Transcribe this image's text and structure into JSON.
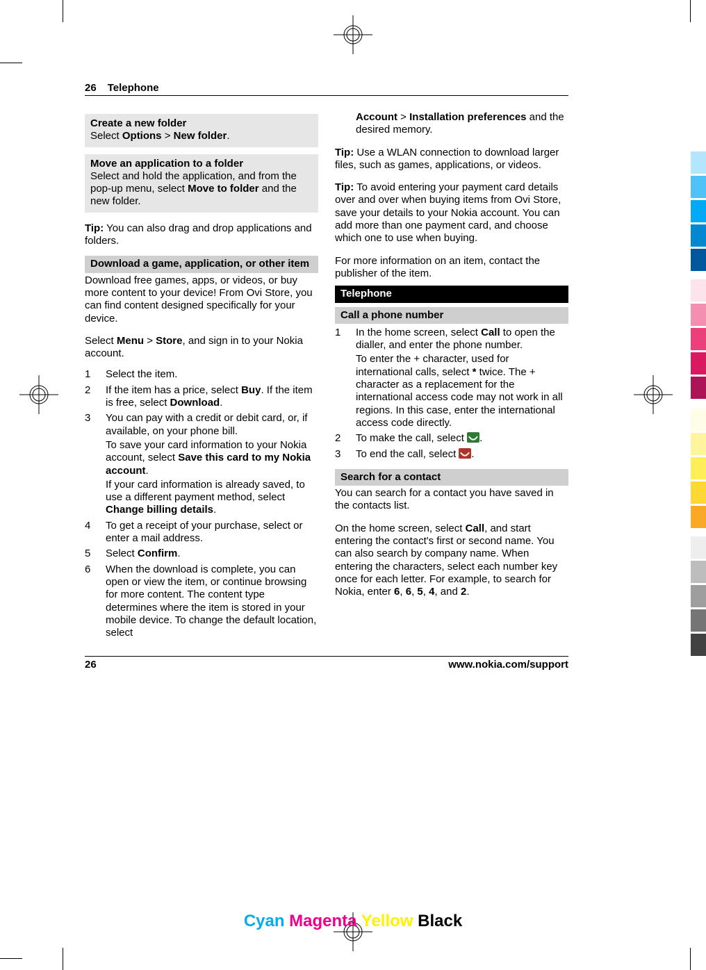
{
  "header": {
    "pageNum": "26",
    "section": "Telephone"
  },
  "left": {
    "createHeader": "Create a new folder",
    "createBody": "Select <b>Options</b>  > <b>New folder</b>.",
    "moveHeader": "Move an application to a folder",
    "moveBody": "Select and hold the application, and from the pop-up menu, select <b>Move to folder</b> and the new folder.",
    "tip1": "<b>Tip:</b> You can also drag and drop applications and folders.",
    "dlHeader": "Download a game, application, or other item",
    "dlBody": "Download free games, apps, or videos, or buy more content to your device! From Ovi Store, you can find content designed specifically for your device.",
    "selectMenu": "Select <b>Menu</b>  > <b>Store</b>, and sign in to your Nokia account.",
    "steps": [
      "Select the item.",
      "If the item has a price, select <b>Buy</b>. If the item is free, select <b>Download</b>.",
      "You can pay with a credit or debit card, or, if available, on your phone bill.|To save your card information to your Nokia account, select <b>Save this card to my Nokia account</b>.|If your card information is already saved, to use a different payment method, select <b>Change billing details</b>.",
      "To get a receipt of your purchase, select or enter a mail address.",
      "Select <b>Confirm</b>.",
      "When the download is complete, you can open or view the item, or continue browsing for more content. The content type determines where the item is stored in your mobile device. To change the default location, select"
    ]
  },
  "right": {
    "cont": "<b>Account</b>  > <b>Installation preferences</b> and the desired memory.",
    "tip2": "<b>Tip:</b> Use a WLAN connection to download larger files, such as games, applications, or videos.",
    "tip3": "<b>Tip:</b> To avoid entering your payment card details over and over when buying items from Ovi Store, save your details to your Nokia account. You can add more than one payment card, and choose which one to use when buying.",
    "moreInfo": "For more information on an item, contact the publisher of the item.",
    "telephoneHeader": "Telephone",
    "callHeader": "Call a phone number",
    "callSteps": [
      "In the home screen, select <b>Call</b> to open the dialler, and enter the phone number.|To enter the + character, used for international calls, select <b>*</b> twice. The + character as a replacement for the international access code may not work in all regions. In this case, enter the international access code directly.",
      "To make the call, select ",
      "To end the call, select "
    ],
    "searchHeader": "Search for a contact",
    "searchBody": "You can search for a contact you have saved in the contacts list.",
    "searchPara": "On the home screen, select <b>Call</b>, and start entering the contact's first or second name. You can also search by company name. When entering the characters, select each number key once for each letter. For example, to search for Nokia, enter <b>6</b>, <b>6</b>, <b>5</b>, <b>4</b>, and <b>2</b>."
  },
  "footer": {
    "pageNum": "26",
    "url": "www.nokia.com/support"
  },
  "cmyk": {
    "c": "Cyan",
    "m": "Magenta",
    "y": "Yellow",
    "k": "Black"
  }
}
